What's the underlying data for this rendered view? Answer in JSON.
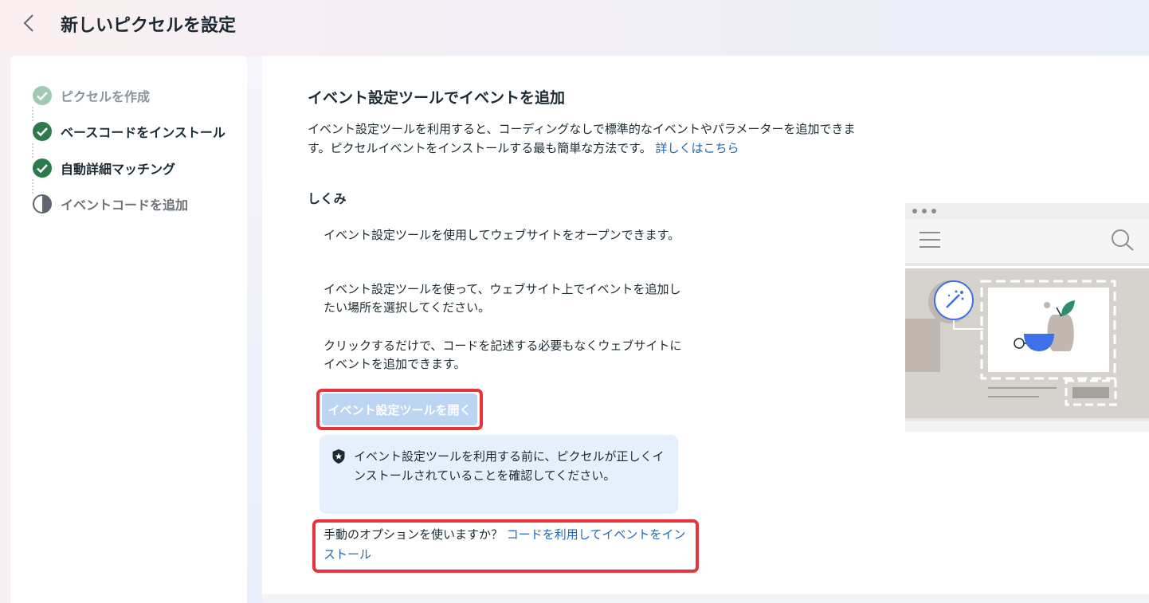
{
  "header": {
    "title": "新しいピクセルを設定"
  },
  "sidebar": {
    "steps": [
      {
        "label": "ピクセルを作成",
        "status": "done-faded"
      },
      {
        "label": "ベースコードをインストール",
        "status": "done"
      },
      {
        "label": "自動詳細マッチング",
        "status": "done"
      },
      {
        "label": "イベントコードを追加",
        "status": "in-progress"
      }
    ]
  },
  "main": {
    "title": "イベント設定ツールでイベントを追加",
    "description": "イベント設定ツールを利用すると、コーディングなしで標準的なイベントやパラメーターを追加できます。ピクセルイベントをインストールする最も簡単な方法です。",
    "learn_more": "詳しくはこちら",
    "how_it_works_title": "しくみ",
    "how_it_works": [
      "イベント設定ツールを使用してウェブサイトをオープンできます。",
      "イベント設定ツールを使って、ウェブサイト上でイベントを追加したい場所を選択してください。",
      "クリックするだけで、コードを記述する必要もなくウェブサイトにイベントを追加できます。"
    ],
    "open_button": "イベント設定ツールを開く",
    "notice": "イベント設定ツールを利用する前に、ピクセルが正しくインストールされていることを確認してください。",
    "manual_prompt": "手動のオプションを使いますか？",
    "manual_link": "コードを利用してイベントをインストール"
  },
  "colors": {
    "check_green": "#2d7a4d",
    "link_blue": "#2268b7",
    "highlight_red": "#e8333a",
    "button_disabled": "#bcd5f3",
    "notice_bg": "#e5f0fc"
  }
}
